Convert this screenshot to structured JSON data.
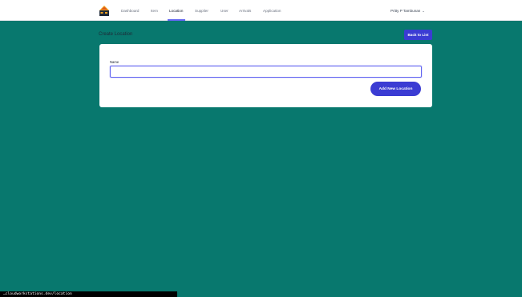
{
  "nav": {
    "items": [
      {
        "label": "Dashboard",
        "active": false
      },
      {
        "label": "Item",
        "active": false
      },
      {
        "label": "Location",
        "active": true
      },
      {
        "label": "Supplier",
        "active": false
      },
      {
        "label": "User",
        "active": false
      },
      {
        "label": "Arrivals",
        "active": false
      },
      {
        "label": "Application",
        "active": false
      }
    ],
    "user_name": "Pritty P Tambunan",
    "logo_icon": "warehouse-logo-icon"
  },
  "page": {
    "title": "Create Location",
    "back_label": "Back to List"
  },
  "form": {
    "name_label": "Name",
    "name_value": "",
    "submit_label": "Add New Location"
  },
  "status_bar": {
    "url": "…cloudworkstations.dev/location"
  },
  "colors": {
    "background": "#08786e",
    "accent": "#3b3cd3",
    "focus_ring": "#6366f1",
    "card": "#ffffff"
  }
}
